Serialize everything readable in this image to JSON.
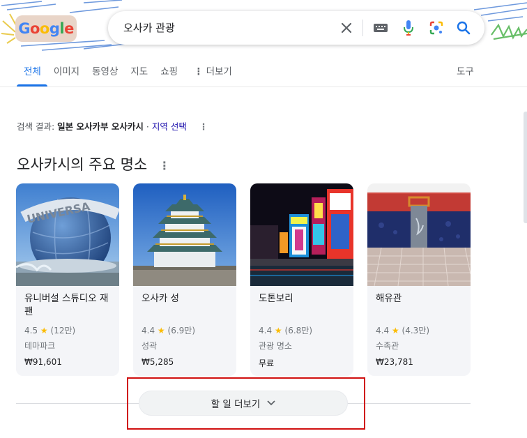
{
  "logo": {
    "letters": [
      "G",
      "o",
      "o",
      "g",
      "l",
      "e"
    ]
  },
  "search": {
    "query": "오사카 관광"
  },
  "tabs": [
    {
      "label": "전체",
      "active": true
    },
    {
      "label": "이미지"
    },
    {
      "label": "동영상"
    },
    {
      "label": "지도"
    },
    {
      "label": "쇼핑"
    },
    {
      "label": "더보기",
      "icon": "more-vert-icon"
    }
  ],
  "tools_label": "도구",
  "location": {
    "prefix": "검색 결과:",
    "place": "일본 오사카부 오사카시",
    "separator": "·",
    "link": "지역 선택"
  },
  "section_title": "오사카시의 주요 명소",
  "cards": [
    {
      "title": "유니버설 스튜디오 재팬",
      "rating": "4.5",
      "reviews": "(12만)",
      "category": "테마파크",
      "price": "₩91,601"
    },
    {
      "title": "오사카 성",
      "rating": "4.4",
      "reviews": "(6.9만)",
      "category": "성곽",
      "price": "₩5,285"
    },
    {
      "title": "도톤보리",
      "rating": "4.4",
      "reviews": "(6.8만)",
      "category": "관광 명소",
      "price": "무료"
    },
    {
      "title": "해유관",
      "rating": "4.4",
      "reviews": "(4.3만)",
      "category": "수족관",
      "price": "₩23,781"
    }
  ],
  "more_button": {
    "label": "할 일 더보기"
  },
  "colors": {
    "accent": "#1a73e8",
    "star": "#fbbc04",
    "link": "#1a0dab",
    "highlight": "#d01010"
  }
}
